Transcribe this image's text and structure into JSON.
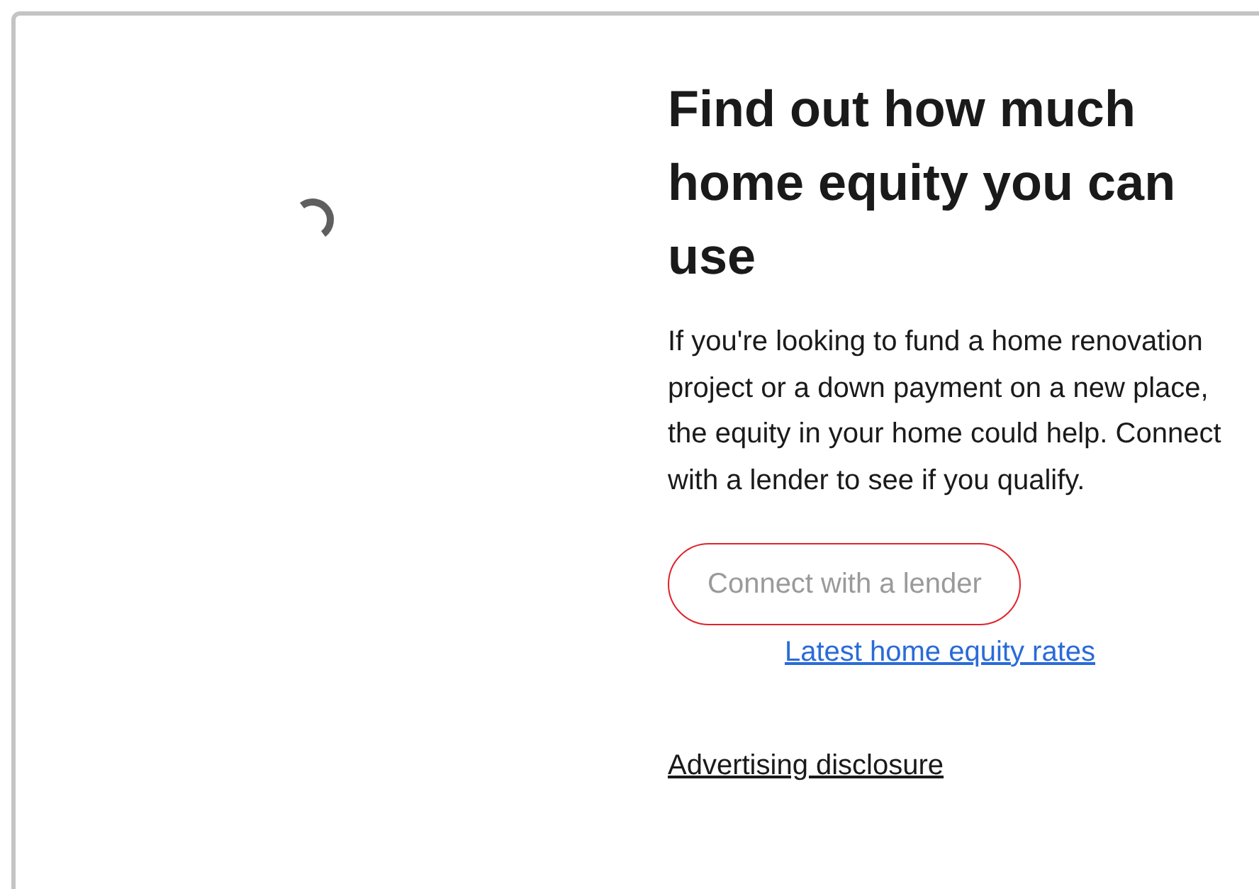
{
  "loading": true,
  "heading": "Find out how much home equity you can use",
  "body": "If you're looking to fund a home renovation project or a down payment on a new place, the equity in your home could help. Connect with a lender to see if you qualify.",
  "button": {
    "label": "Connect with a lender",
    "disabled": true
  },
  "rates_link": "Latest home equity rates",
  "disclosure_link": "Advertising disclosure"
}
